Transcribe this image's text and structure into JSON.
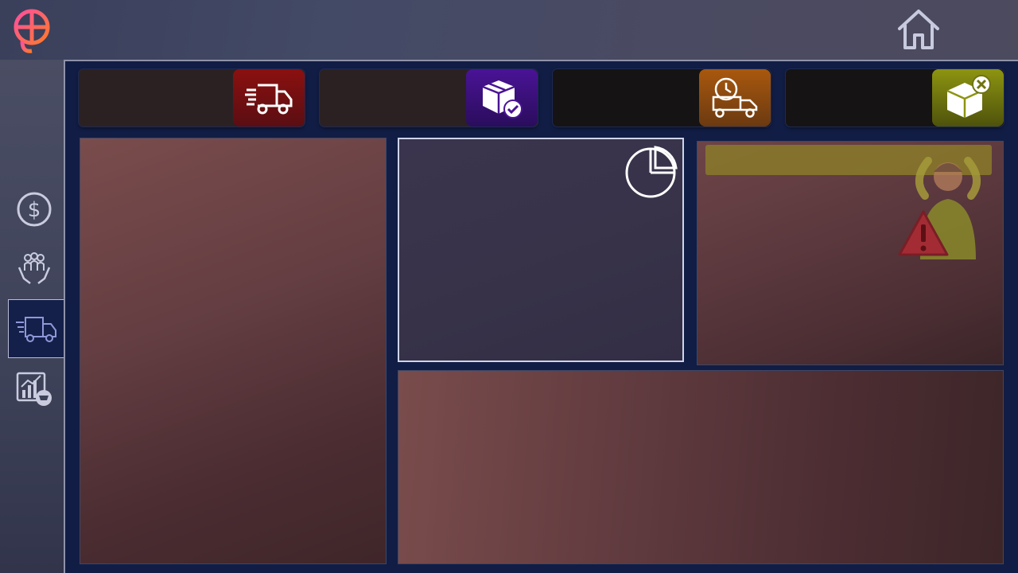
{
  "app": {
    "logo_icon": "brand-logo-icon",
    "home_icon": "home-icon"
  },
  "sidebar": {
    "items": [
      {
        "icon": "dollar-circle-icon",
        "active": false
      },
      {
        "icon": "people-in-hands-icon",
        "active": false
      },
      {
        "icon": "delivery-truck-icon",
        "active": true
      },
      {
        "icon": "chart-cart-icon",
        "active": false
      }
    ]
  },
  "kpi_cards": [
    {
      "icon": "fast-delivery-truck-icon",
      "accent": "#8b1010",
      "value": ""
    },
    {
      "icon": "package-check-icon",
      "accent": "#4a1396",
      "value": ""
    },
    {
      "icon": "timer-truck-icon",
      "accent": "#a9580e",
      "value": ""
    },
    {
      "icon": "package-cancel-icon",
      "accent": "#8d9410",
      "value": ""
    }
  ],
  "panels": {
    "center_icon": "pie-chart-icon",
    "alert_icon": "warning-triangle-icon"
  },
  "colors": {
    "main_background": "#121d45",
    "panel_red": "#6a4143",
    "panel_center": "#383349",
    "alert_bar": "#8a7a2a"
  }
}
